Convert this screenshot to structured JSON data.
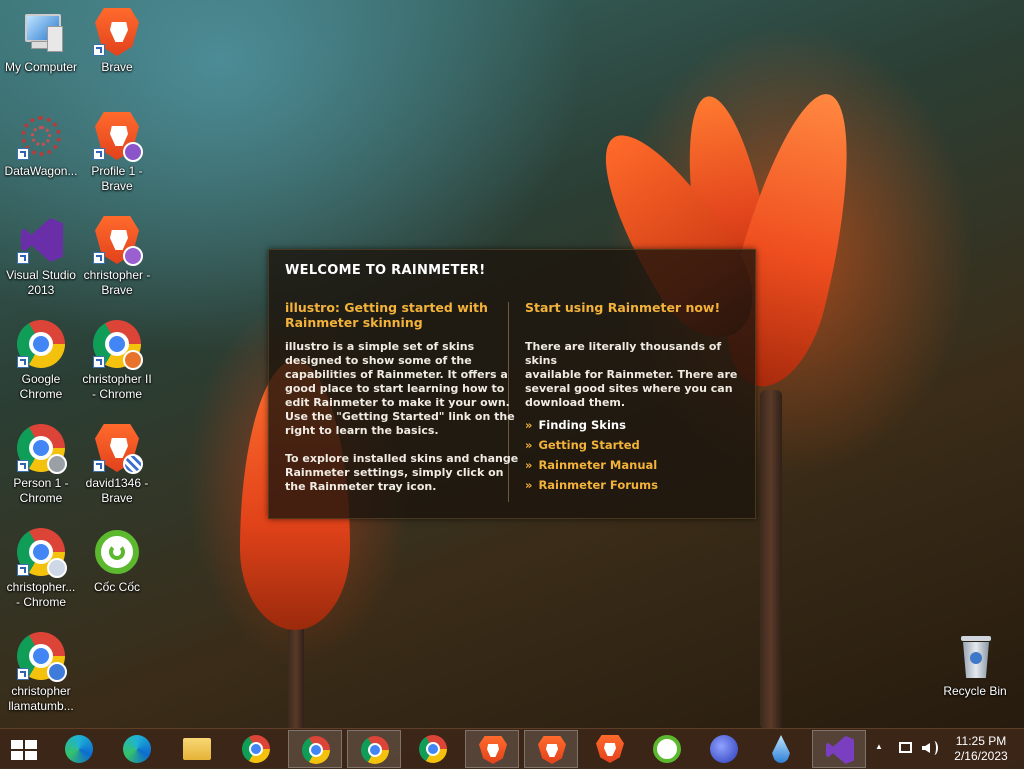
{
  "desktop": {
    "icons": [
      {
        "label": "My Computer",
        "icon": "computer-icon"
      },
      {
        "label": "Brave",
        "icon": "brave-icon"
      },
      {
        "label": "DataWagon...",
        "icon": "datawagon-icon"
      },
      {
        "label": "Profile 1 -\nBrave",
        "icon": "brave-icon"
      },
      {
        "label": "Visual Studio\n2013",
        "icon": "visual-studio-icon"
      },
      {
        "label": "christopher -\nBrave",
        "icon": "brave-icon"
      },
      {
        "label": "Google\nChrome",
        "icon": "chrome-icon"
      },
      {
        "label": "christopher II\n- Chrome",
        "icon": "chrome-icon"
      },
      {
        "label": "Person 1 -\nChrome",
        "icon": "chrome-icon"
      },
      {
        "label": "david1346 -\nBrave",
        "icon": "brave-icon"
      },
      {
        "label": "christopher...\n- Chrome",
        "icon": "chrome-icon"
      },
      {
        "label": "Cốc Cốc",
        "icon": "coccoc-icon"
      },
      {
        "label": "christopher\nllamatumb...",
        "icon": "chrome-icon"
      },
      {
        "label": "Recycle Bin",
        "icon": "recycle-bin-icon"
      }
    ]
  },
  "rainmeter": {
    "title": "WELCOME TO RAINMETER!",
    "left_heading": "illustro: Getting started with\nRainmeter skinning",
    "left_para1": "illustro is a simple set of skins\ndesigned to show some of the\ncapabilities of Rainmeter. It offers a\ngood place to start learning how to\nedit Rainmeter to make it your own.\nUse the \"Getting Started\" link on the\nright to learn the basics.",
    "left_para2": "To explore installed skins and change\nRainmeter settings, simply click on\nthe Rainmeter tray icon.",
    "right_heading": "Start using Rainmeter now!",
    "right_para": "There are literally thousands of skins\navailable for Rainmeter. There are\nseveral good sites where you can\ndownload them.",
    "links": [
      "Finding Skins",
      "Getting Started",
      "Rainmeter Manual",
      "Rainmeter Forums"
    ],
    "bullet": "»"
  },
  "taskbar": {
    "apps": [
      "start-button",
      "edge-profile-icon",
      "edge-profile-icon",
      "file-explorer-icon",
      "chrome-icon",
      "chrome-icon",
      "chrome-icon",
      "chrome-icon",
      "brave-icon",
      "brave-icon",
      "brave-icon",
      "coccoc-icon",
      "virus-icon",
      "droplet-icon",
      "visual-studio-icon"
    ],
    "clock": {
      "time": "11:25 PM",
      "date": "2/16/2023"
    },
    "tray_chevron": "▲",
    "colors": {
      "accent": "#f3b23a",
      "taskbar": "#3c2618"
    }
  }
}
